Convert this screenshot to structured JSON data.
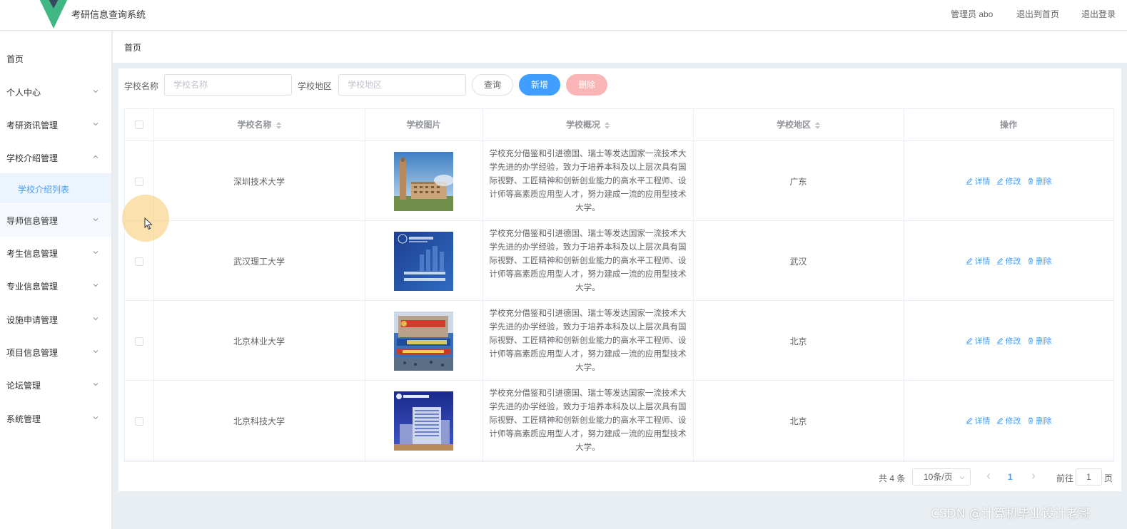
{
  "header": {
    "app_title": "考研信息查询系统",
    "admin_label": "管理员 abo",
    "back_to_home": "退出到首页",
    "logout": "退出登录"
  },
  "sidebar": {
    "items": [
      {
        "label": "首页"
      },
      {
        "label": "个人中心"
      },
      {
        "label": "考研资讯管理"
      },
      {
        "label": "学校介绍管理"
      },
      {
        "label": "学校介绍列表"
      },
      {
        "label": "导师信息管理"
      },
      {
        "label": "考生信息管理"
      },
      {
        "label": "专业信息管理"
      },
      {
        "label": "设施申请管理"
      },
      {
        "label": "项目信息管理"
      },
      {
        "label": "论坛管理"
      },
      {
        "label": "系统管理"
      }
    ]
  },
  "breadcrumb": "首页",
  "search": {
    "name_label": "学校名称",
    "name_placeholder": "学校名称",
    "region_label": "学校地区",
    "region_placeholder": "学校地区",
    "query_button": "查询",
    "add_button": "新增",
    "delete_button": "删除"
  },
  "table": {
    "columns": [
      "学校名称",
      "学校图片",
      "学校概况",
      "学校地区",
      "操作"
    ],
    "rows": [
      {
        "name": "深圳技术大学",
        "overview": "学校充分借鉴和引进德国、瑞士等发达国家一流技术大学先进的办学经验，致力于培养本科及以上层次具有国际视野、工匠精神和创新创业能力的高水平工程师、设计师等高素质应用型人才，努力建成一流的应用型技术大学。",
        "region": "广东"
      },
      {
        "name": "武汉理工大学",
        "overview": "学校充分借鉴和引进德国、瑞士等发达国家一流技术大学先进的办学经验，致力于培养本科及以上层次具有国际视野、工匠精神和创新创业能力的高水平工程师、设计师等高素质应用型人才，努力建成一流的应用型技术大学。",
        "region": "武汉"
      },
      {
        "name": "北京林业大学",
        "overview": "学校充分借鉴和引进德国、瑞士等发达国家一流技术大学先进的办学经验，致力于培养本科及以上层次具有国际视野、工匠精神和创新创业能力的高水平工程师、设计师等高素质应用型人才，努力建成一流的应用型技术大学。",
        "region": "北京"
      },
      {
        "name": "北京科技大学",
        "overview": "学校充分借鉴和引进德国、瑞士等发达国家一流技术大学先进的办学经验，致力于培养本科及以上层次具有国际视野、工匠精神和创新创业能力的高水平工程师、设计师等高素质应用型人才，努力建成一流的应用型技术大学。",
        "region": "北京"
      }
    ],
    "actions": {
      "detail": "详情",
      "edit": "修改",
      "delete": "删除"
    }
  },
  "pagination": {
    "total": "共 4 条",
    "page_size": "10条/页",
    "current_page": "1",
    "goto_label": "前往",
    "goto_value": "1",
    "goto_unit": "页"
  },
  "watermark": "CSDN @计算机毕业设计老哥",
  "colors": {
    "primary": "#409eff",
    "danger_disabled": "#fab6b6",
    "page_bg": "#e9eef3",
    "active_menu_bg": "#ecf5ff"
  }
}
